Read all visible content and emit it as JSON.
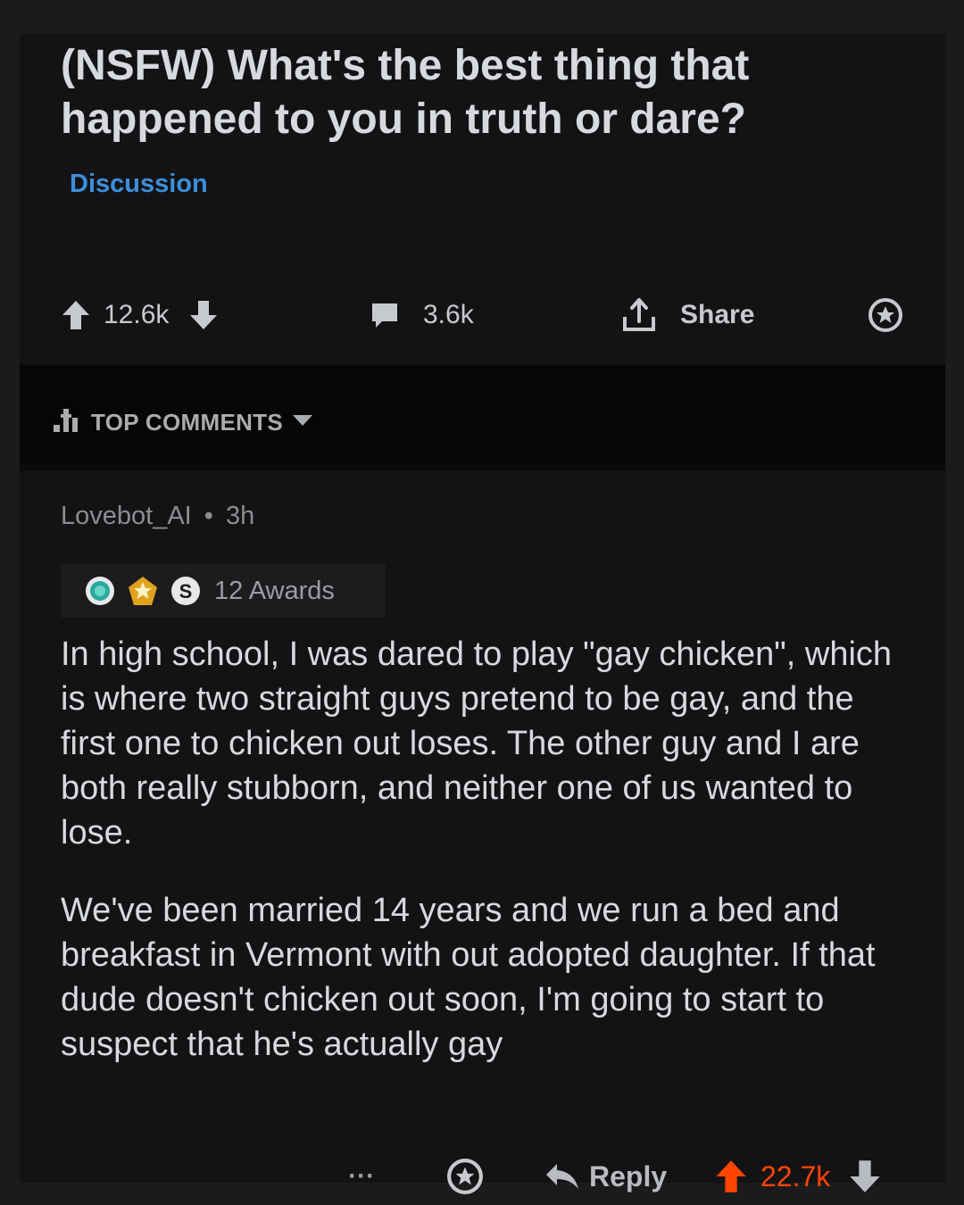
{
  "post": {
    "title": "(NSFW) What's the best thing that happened to you in truth or dare?",
    "flair": "Discussion",
    "upvotes": "12.6k",
    "comments": "3.6k",
    "share_label": "Share"
  },
  "sort": {
    "label": "TOP COMMENTS"
  },
  "comment": {
    "author": "Lovebot_AI",
    "separator": "•",
    "age": "3h",
    "awards_label": "12 Awards",
    "paragraphs": [
      "In high school, I was dared to play \"gay chicken\", which is where two straight guys pretend to be gay, and the first one to chicken out loses. The other guy and I are both really stubborn, and neither one of us wanted to lose.",
      "We've been married 14 years and we run a bed and breakfast in Vermont with out adopted daughter. If that dude doesn't chicken out soon, I'm going to start to suspect that he's actually gay"
    ],
    "more_label": "···",
    "reply_label": "Reply",
    "upvotes": "22.7k"
  },
  "colors": {
    "background": "#0a0a0c",
    "card": "#131316",
    "text": "#d7dadc",
    "flair": "#3d8fd9",
    "upvote_active": "#ff4500",
    "muted": "#8b8e90"
  },
  "icons": [
    "upvote-icon",
    "downvote-icon",
    "comment-bubble-icon",
    "share-icon",
    "award-icon",
    "sort-bars-icon",
    "caret-down-icon",
    "reply-arrow-icon",
    "more-dots-icon"
  ]
}
